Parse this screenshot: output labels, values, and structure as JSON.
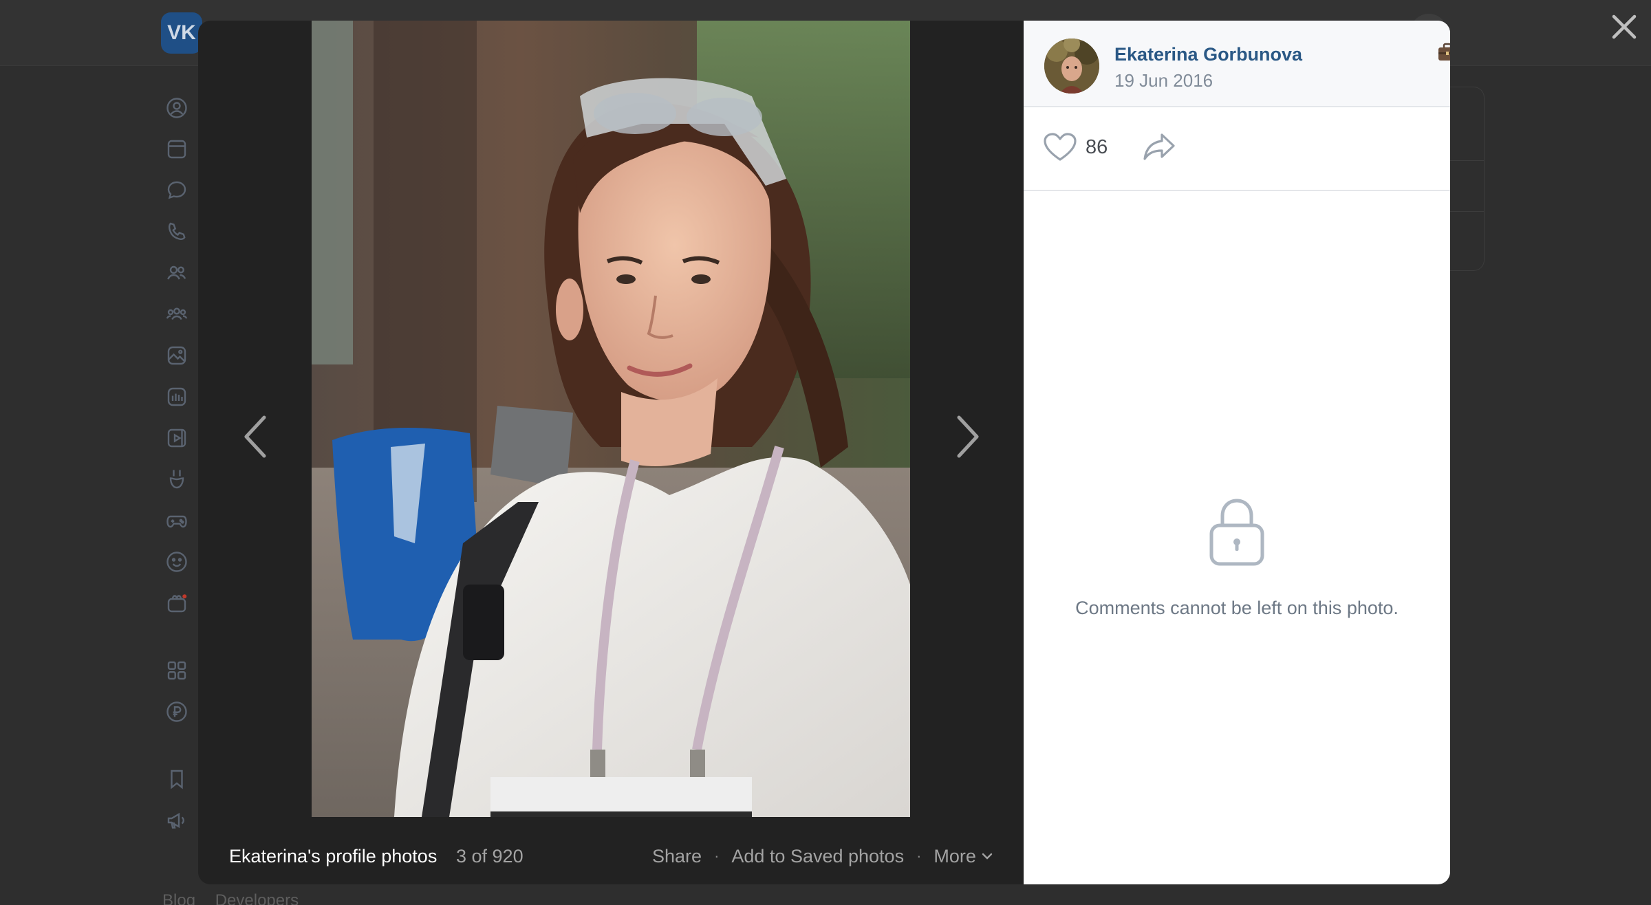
{
  "background_page": {
    "logo_text": "VK",
    "footer_links": [
      "Blog",
      "Developers"
    ]
  },
  "viewer": {
    "album_title": "Ekaterina's profile photos",
    "counter": "3 of 920",
    "actions": {
      "share": "Share",
      "save": "Add to Saved photos",
      "more": "More",
      "separator": "·"
    },
    "icons": {
      "prev": "chevron-left-icon",
      "next": "chevron-right-icon",
      "close": "close-icon"
    }
  },
  "side_panel": {
    "author_name": "Ekaterina Gorbunova",
    "author_badge": "briefcase-icon",
    "date": "19 Jun 2016",
    "likes": "86",
    "comments_locked_text": "Comments cannot be left on this photo."
  },
  "colors": {
    "overlay": "#2e2e2e",
    "stage": "#222222",
    "link": "#2a5885",
    "muted": "#818c99"
  }
}
